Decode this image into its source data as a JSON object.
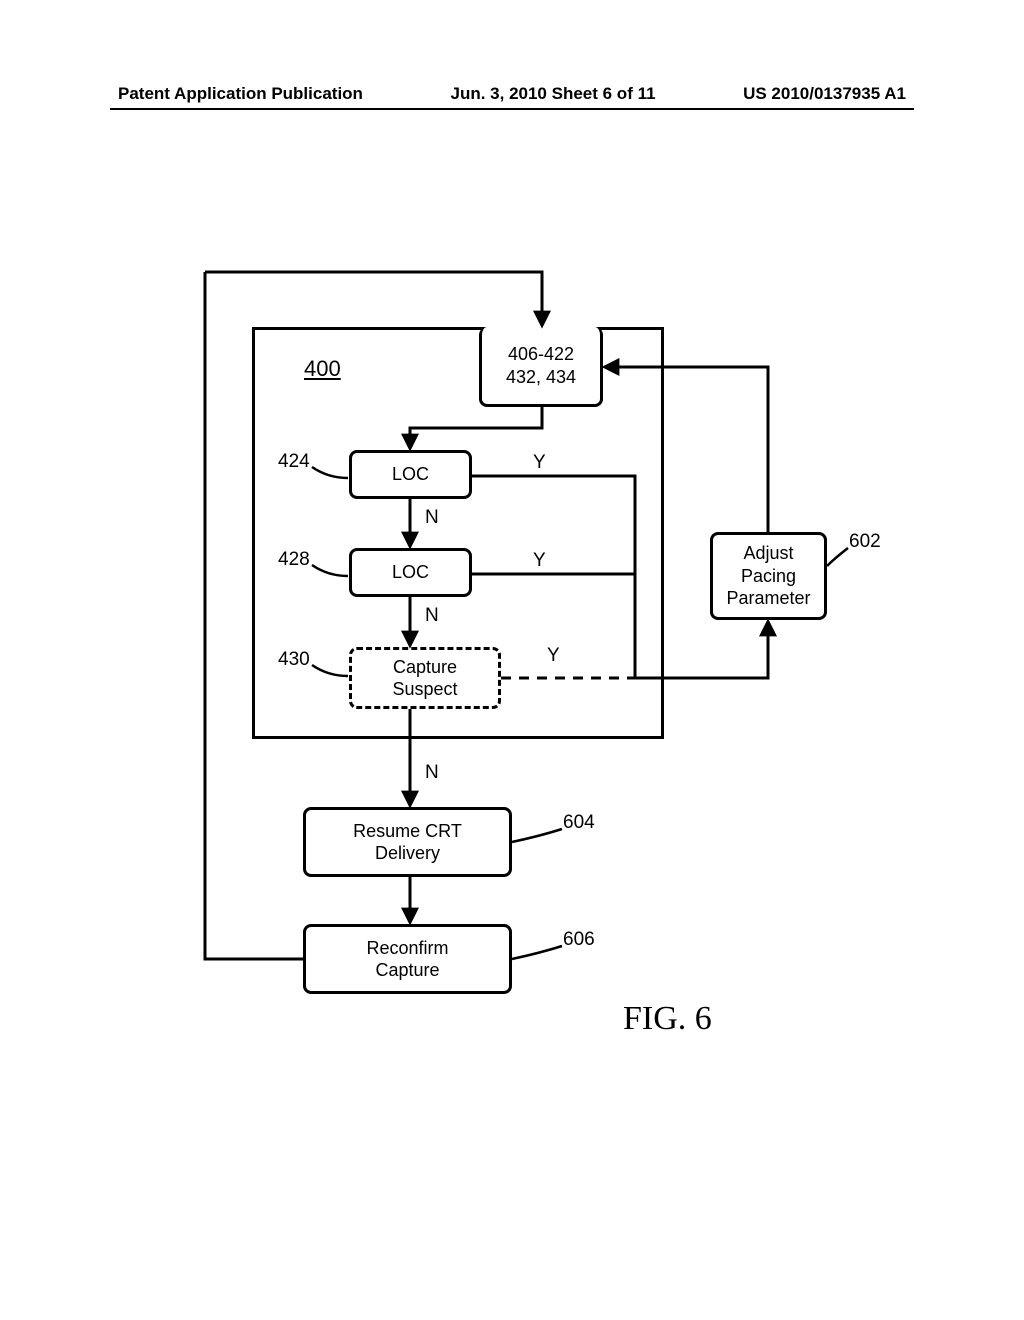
{
  "header": {
    "left": "Patent Application Publication",
    "center": "Jun. 3, 2010 Sheet 6 of 11",
    "right": "US 2010/0137935 A1"
  },
  "refs": {
    "r400": "400",
    "r406_422": "406-422\n432, 434",
    "r424": "424",
    "r428": "428",
    "r430": "430",
    "r602": "602",
    "r604": "604",
    "r606": "606"
  },
  "boxes": {
    "loc1": "LOC",
    "loc2": "LOC",
    "capsus": "Capture\nSuspect",
    "adjust": "Adjust\nPacing\nParameter",
    "resume": "Resume CRT\nDelivery",
    "reconfirm": "Reconfirm\nCapture"
  },
  "branch": {
    "y": "Y",
    "n": "N"
  },
  "figcap": "FIG. 6"
}
